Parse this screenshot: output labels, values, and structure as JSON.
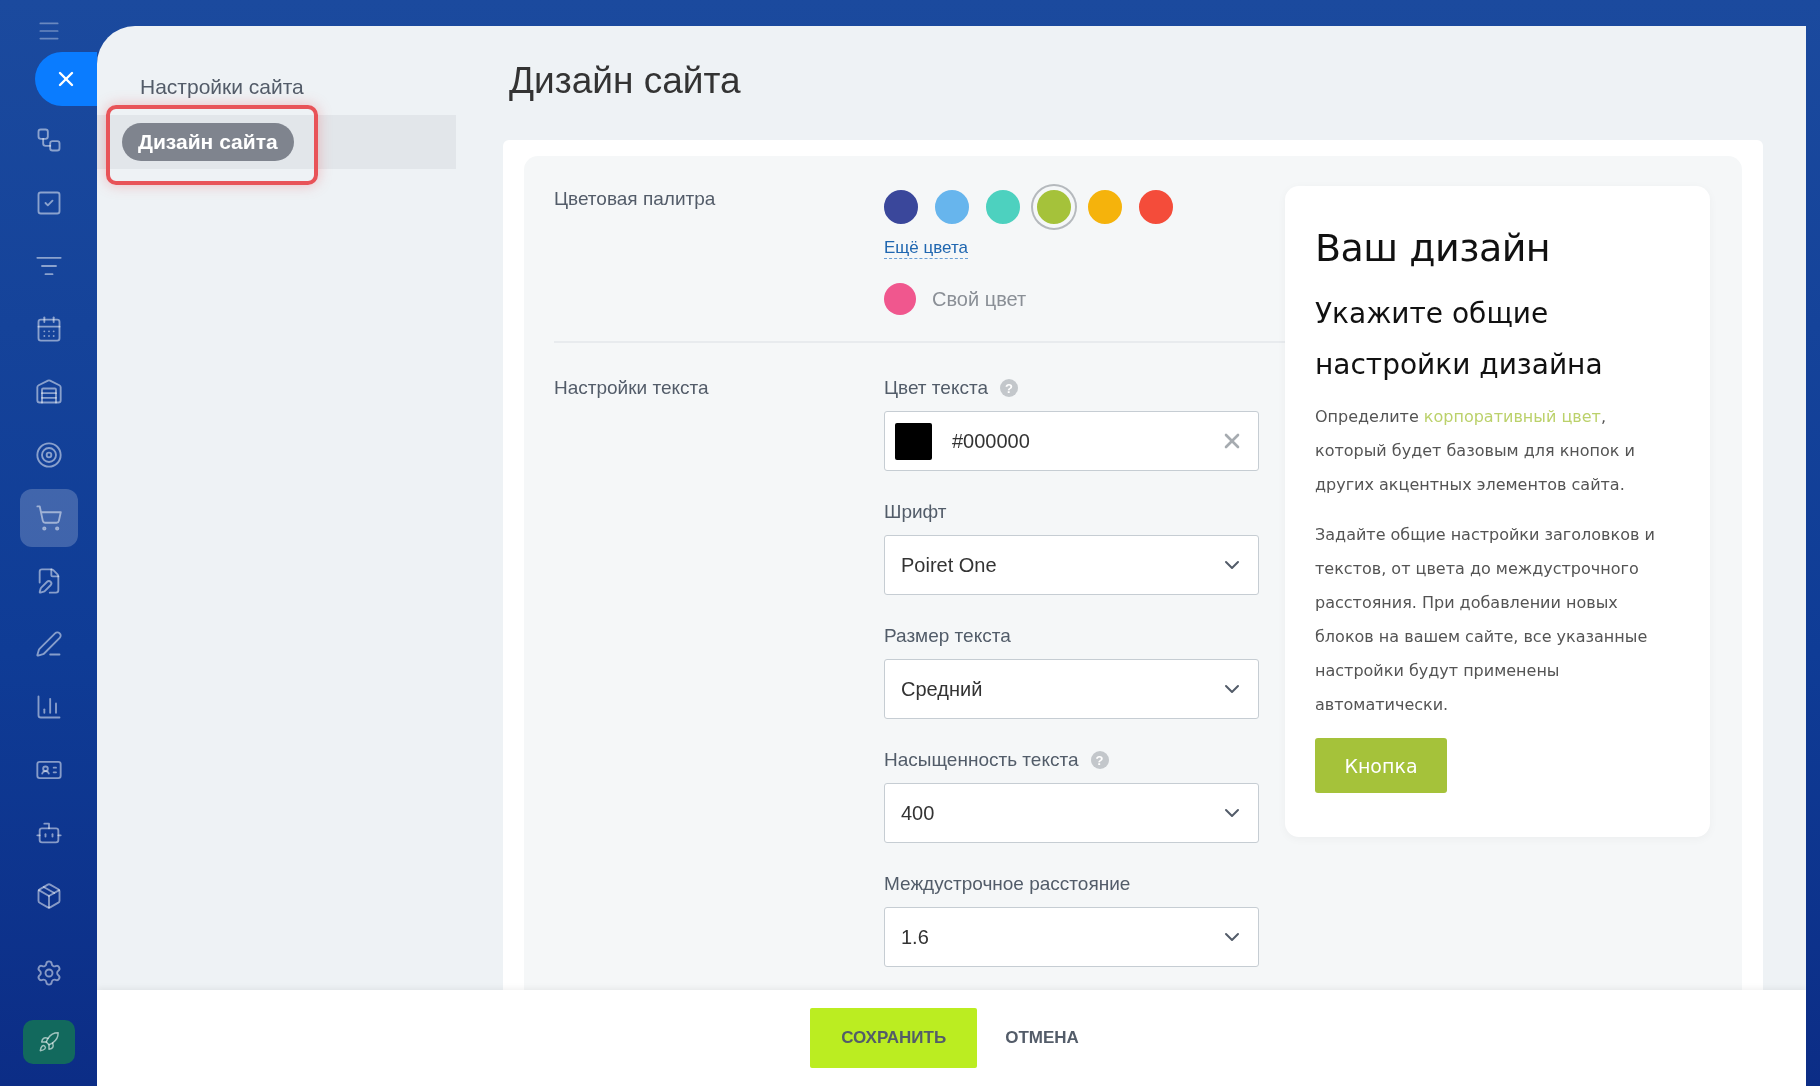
{
  "rail": {
    "items": [
      {
        "selected": false
      },
      {
        "selected": false
      },
      {
        "selected": false
      },
      {
        "selected": false
      },
      {
        "selected": false
      },
      {
        "selected": false
      },
      {
        "selected": true
      },
      {
        "selected": false
      },
      {
        "selected": false
      },
      {
        "selected": false
      },
      {
        "selected": false
      },
      {
        "selected": false
      },
      {
        "selected": false
      }
    ]
  },
  "nav": {
    "title": "Настройки сайта",
    "items": [
      {
        "label": "Дизайн сайта",
        "selected": true,
        "highlighted": true
      }
    ]
  },
  "page_title": "Дизайн сайта",
  "palette": {
    "label": "Цветовая палитра",
    "colors": [
      {
        "color": "#3a479b",
        "selected": false
      },
      {
        "color": "#67b5ed",
        "selected": false
      },
      {
        "color": "#4dd1bf",
        "selected": false
      },
      {
        "color": "#a5c23a",
        "selected": true
      },
      {
        "color": "#f5b30c",
        "selected": false
      },
      {
        "color": "#f44c3a",
        "selected": false
      }
    ],
    "more_link": "Ещё цвета",
    "custom": {
      "color": "#f0578e",
      "label": "Свой цвет"
    }
  },
  "text_settings": {
    "label": "Настройки текста",
    "fields": [
      {
        "kind": "color",
        "label": "Цвет текста",
        "help": "?",
        "value": "#000000"
      },
      {
        "kind": "select",
        "label": "Шрифт",
        "value": "Poiret One"
      },
      {
        "kind": "select",
        "label": "Размер текста",
        "value": "Средний"
      },
      {
        "kind": "select",
        "label": "Насыщенность текста",
        "help": "?",
        "value": "400"
      },
      {
        "kind": "select",
        "label": "Междустрочное расстояние",
        "value": "1.6"
      }
    ]
  },
  "preview": {
    "title": "Ваш дизайн",
    "subtitle": "Укажите общие настройки дизайна",
    "paragraphs": [
      {
        "before": "Определите ",
        "link": "корпоративный цвет",
        "after": ", который будет базовым для кнопок и других акцентных элементов сайта."
      },
      {
        "before": "Задайте общие настройки заголовков и текстов, от цвета до междустрочного расстояния. При добавлении новых блоков на вашем сайте, все указанные настройки будут применены автоматически."
      }
    ],
    "button": "Кнопка"
  },
  "footer": {
    "save": "СОХРАНИТЬ",
    "cancel": "ОТМЕНА"
  }
}
